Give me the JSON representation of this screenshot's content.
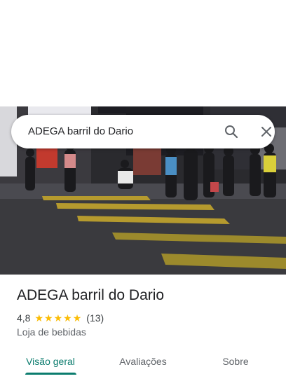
{
  "search": {
    "query": "ADEGA barril do Dario"
  },
  "place": {
    "name": "ADEGA barril do Dario",
    "rating": "4,8",
    "stars": 5,
    "review_count": "(13)",
    "category": "Loja de bebidas"
  },
  "tabs": [
    {
      "label": "Visão geral",
      "active": true
    },
    {
      "label": "Avaliações",
      "active": false
    },
    {
      "label": "Sobre",
      "active": false
    }
  ],
  "colors": {
    "accent": "#0b7c6e",
    "star": "#fbbc04"
  },
  "icons": {
    "search": "search-icon",
    "close": "close-icon"
  }
}
